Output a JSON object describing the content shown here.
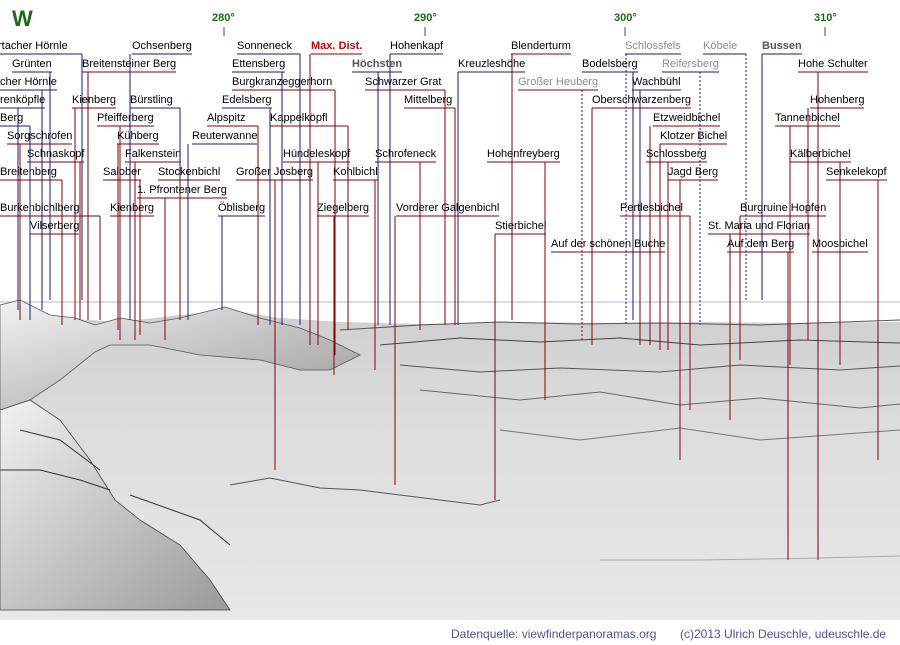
{
  "compass": "W",
  "degrees": [
    "280°",
    "290°",
    "300°",
    "310°"
  ],
  "peaks": [
    {
      "name": "rtacher Hörnle",
      "style": "normal"
    },
    {
      "name": "Ochsenberg",
      "style": "normal"
    },
    {
      "name": "Sonneneck",
      "style": "normal"
    },
    {
      "name": "Max. Dist.",
      "style": "red"
    },
    {
      "name": "Hohenkapf",
      "style": "normal"
    },
    {
      "name": "Blenderturm",
      "style": "normal"
    },
    {
      "name": "Schlossfels",
      "style": "grey"
    },
    {
      "name": "Köbele",
      "style": "grey"
    },
    {
      "name": "Bussen",
      "style": "bold"
    },
    {
      "name": "Grünten",
      "style": "normal"
    },
    {
      "name": "Breitensteiner Berg",
      "style": "normal"
    },
    {
      "name": "Ettensberg",
      "style": "normal"
    },
    {
      "name": "Höchsten",
      "style": "bold"
    },
    {
      "name": "Kreuzleshöhe",
      "style": "normal"
    },
    {
      "name": "Bodelsberg",
      "style": "normal"
    },
    {
      "name": "Reifersberg",
      "style": "grey"
    },
    {
      "name": "Hohe Schulter",
      "style": "normal"
    },
    {
      "name": "cher Hörnle",
      "style": "normal"
    },
    {
      "name": "Burgkranzeggerhorn",
      "style": "normal"
    },
    {
      "name": "Schwarzer Grat",
      "style": "normal"
    },
    {
      "name": "Großer Heuberg",
      "style": "grey"
    },
    {
      "name": "Wachbühl",
      "style": "normal"
    },
    {
      "name": "renköpfle",
      "style": "normal"
    },
    {
      "name": "Kienberg",
      "style": "normal"
    },
    {
      "name": "Bürstling",
      "style": "normal"
    },
    {
      "name": "Edelsberg",
      "style": "normal"
    },
    {
      "name": "Mittelberg",
      "style": "normal"
    },
    {
      "name": "Oberschwarzenberg",
      "style": "normal"
    },
    {
      "name": "Hohenberg",
      "style": "normal"
    },
    {
      "name": "Berg",
      "style": "normal"
    },
    {
      "name": "Pfeifferberg",
      "style": "normal"
    },
    {
      "name": "Alpspitz",
      "style": "normal"
    },
    {
      "name": "Kappelköpfl",
      "style": "normal"
    },
    {
      "name": "Etzweidbichel",
      "style": "normal"
    },
    {
      "name": "Tannenbichel",
      "style": "normal"
    },
    {
      "name": "Sorgschrofen",
      "style": "normal"
    },
    {
      "name": "Kühberg",
      "style": "normal"
    },
    {
      "name": "Reuterwanne",
      "style": "normal"
    },
    {
      "name": "Klotzer Bichel",
      "style": "normal"
    },
    {
      "name": "Schnaskopf",
      "style": "normal"
    },
    {
      "name": "Falkenstein",
      "style": "normal"
    },
    {
      "name": "Hündeleskopf",
      "style": "normal"
    },
    {
      "name": "Schrofeneck",
      "style": "normal"
    },
    {
      "name": "Hohenfreyberg",
      "style": "normal"
    },
    {
      "name": "Schlossberg",
      "style": "normal"
    },
    {
      "name": "Kälberbichel",
      "style": "normal"
    },
    {
      "name": "Breitenberg",
      "style": "normal"
    },
    {
      "name": "Salober",
      "style": "normal"
    },
    {
      "name": "Stockenbichl",
      "style": "normal"
    },
    {
      "name": "Großer Josberg",
      "style": "normal"
    },
    {
      "name": "Kohlbichl",
      "style": "normal"
    },
    {
      "name": "Jagd Berg",
      "style": "normal"
    },
    {
      "name": "Senkelekopf",
      "style": "normal"
    },
    {
      "name": "1. Pfrontener Berg",
      "style": "normal"
    },
    {
      "name": "Burkenbichlberg",
      "style": "normal"
    },
    {
      "name": "Kienberg",
      "style": "normal"
    },
    {
      "name": "Öblisberg",
      "style": "normal"
    },
    {
      "name": "Ziegelberg",
      "style": "normal"
    },
    {
      "name": "Vorderer Galgenbichl",
      "style": "normal"
    },
    {
      "name": "Pertlesbichel",
      "style": "normal"
    },
    {
      "name": "Burgruine Hopfen",
      "style": "normal"
    },
    {
      "name": "Vilserberg",
      "style": "normal"
    },
    {
      "name": "Stierbichel",
      "style": "normal"
    },
    {
      "name": "St. Maria und Florian",
      "style": "normal"
    },
    {
      "name": "Auf der schönen Buche",
      "style": "normal"
    },
    {
      "name": "Auf dem Berg",
      "style": "normal"
    },
    {
      "name": "Moosbichel",
      "style": "normal"
    }
  ],
  "footer": {
    "source": "Datenquelle: viewfinderpanoramas.org",
    "copyright": "(c)2013 Ulrich Deuschle, udeuschle.de"
  }
}
